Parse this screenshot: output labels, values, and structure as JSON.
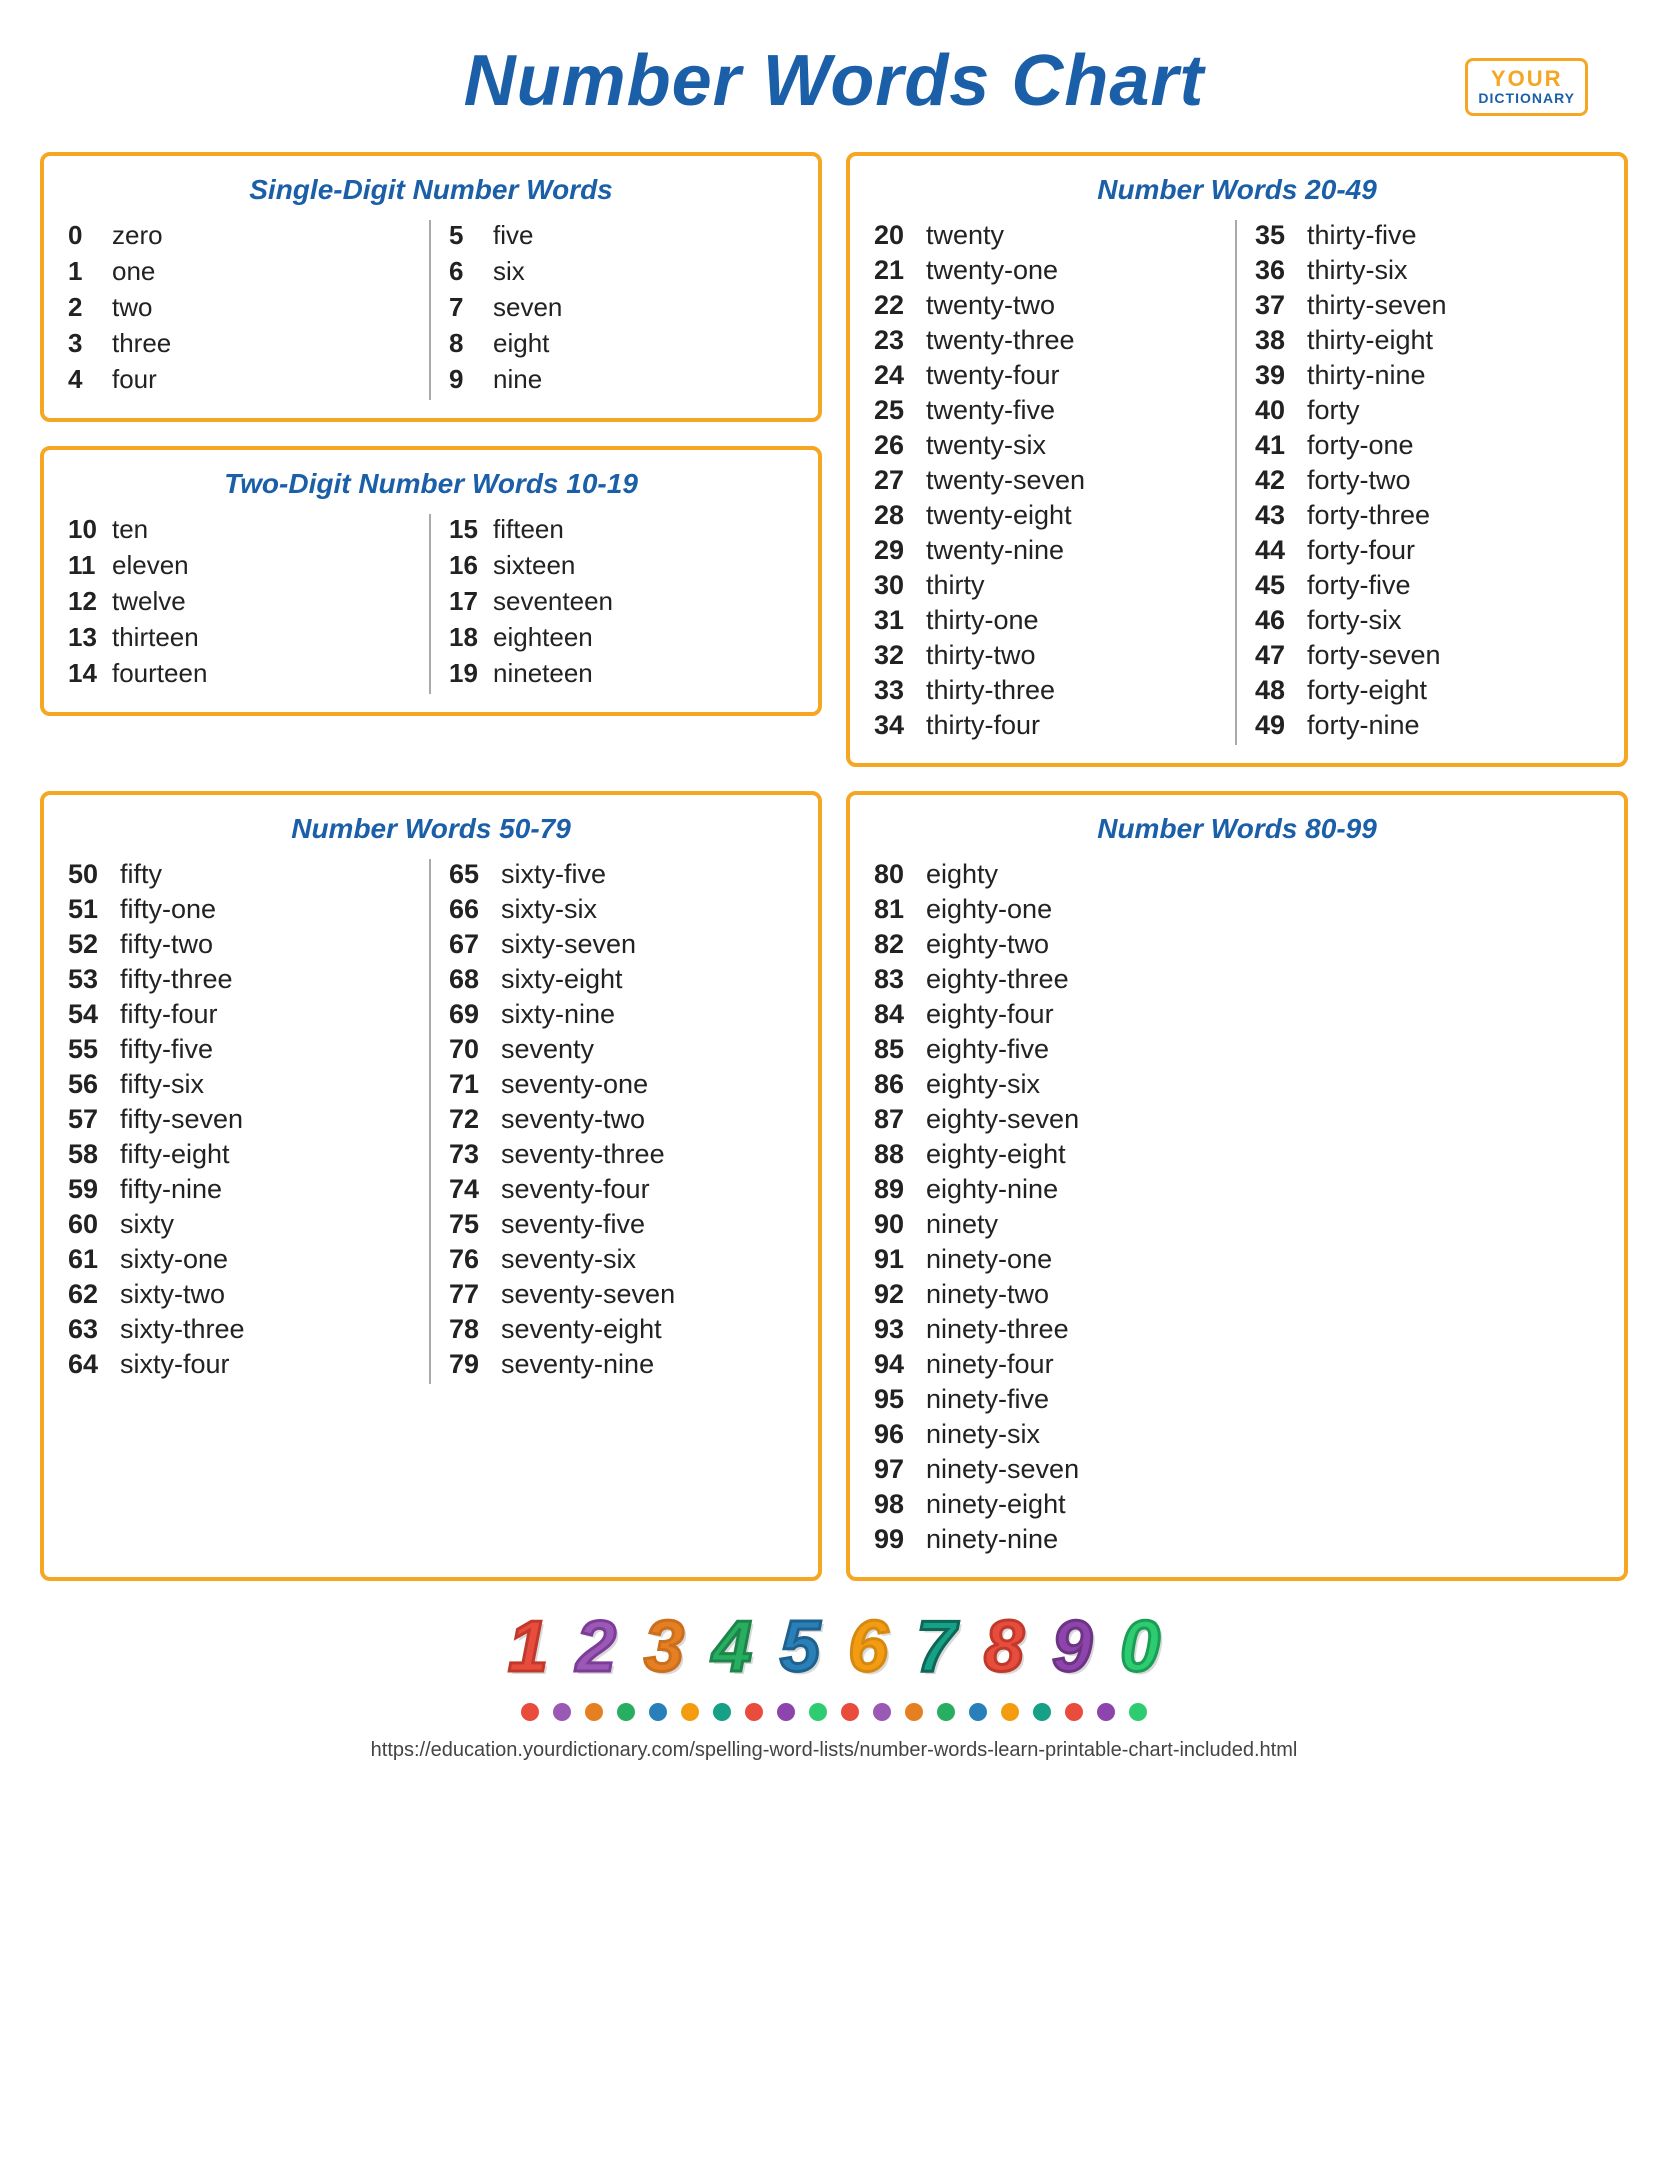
{
  "logo": {
    "your": "YOUR",
    "dictionary": "DICTIONARY"
  },
  "title": "Number Words Chart",
  "boxes": {
    "single_digit": {
      "title": "Single-Digit Number Words",
      "col1": [
        {
          "num": "0",
          "word": "zero"
        },
        {
          "num": "1",
          "word": "one"
        },
        {
          "num": "2",
          "word": "two"
        },
        {
          "num": "3",
          "word": "three"
        },
        {
          "num": "4",
          "word": "four"
        }
      ],
      "col2": [
        {
          "num": "5",
          "word": "five"
        },
        {
          "num": "6",
          "word": "six"
        },
        {
          "num": "7",
          "word": "seven"
        },
        {
          "num": "8",
          "word": "eight"
        },
        {
          "num": "9",
          "word": "nine"
        }
      ]
    },
    "two_digit": {
      "title": "Two-Digit Number Words 10-19",
      "col1": [
        {
          "num": "10",
          "word": "ten"
        },
        {
          "num": "11",
          "word": "eleven"
        },
        {
          "num": "12",
          "word": "twelve"
        },
        {
          "num": "13",
          "word": "thirteen"
        },
        {
          "num": "14",
          "word": "fourteen"
        }
      ],
      "col2": [
        {
          "num": "15",
          "word": "fifteen"
        },
        {
          "num": "16",
          "word": "sixteen"
        },
        {
          "num": "17",
          "word": "seventeen"
        },
        {
          "num": "18",
          "word": "eighteen"
        },
        {
          "num": "19",
          "word": "nineteen"
        }
      ]
    },
    "twenties": {
      "title": "Number Words 20-49",
      "col1": [
        {
          "num": "20",
          "word": "twenty"
        },
        {
          "num": "21",
          "word": "twenty-one"
        },
        {
          "num": "22",
          "word": "twenty-two"
        },
        {
          "num": "23",
          "word": "twenty-three"
        },
        {
          "num": "24",
          "word": "twenty-four"
        },
        {
          "num": "25",
          "word": "twenty-five"
        },
        {
          "num": "26",
          "word": "twenty-six"
        },
        {
          "num": "27",
          "word": "twenty-seven"
        },
        {
          "num": "28",
          "word": "twenty-eight"
        },
        {
          "num": "29",
          "word": "twenty-nine"
        },
        {
          "num": "30",
          "word": "thirty"
        },
        {
          "num": "31",
          "word": "thirty-one"
        },
        {
          "num": "32",
          "word": "thirty-two"
        },
        {
          "num": "33",
          "word": "thirty-three"
        },
        {
          "num": "34",
          "word": "thirty-four"
        }
      ],
      "col2": [
        {
          "num": "35",
          "word": "thirty-five"
        },
        {
          "num": "36",
          "word": "thirty-six"
        },
        {
          "num": "37",
          "word": "thirty-seven"
        },
        {
          "num": "38",
          "word": "thirty-eight"
        },
        {
          "num": "39",
          "word": "thirty-nine"
        },
        {
          "num": "40",
          "word": "forty"
        },
        {
          "num": "41",
          "word": "forty-one"
        },
        {
          "num": "42",
          "word": "forty-two"
        },
        {
          "num": "43",
          "word": "forty-three"
        },
        {
          "num": "44",
          "word": "forty-four"
        },
        {
          "num": "45",
          "word": "forty-five"
        },
        {
          "num": "46",
          "word": "forty-six"
        },
        {
          "num": "47",
          "word": "forty-seven"
        },
        {
          "num": "48",
          "word": "forty-eight"
        },
        {
          "num": "49",
          "word": "forty-nine"
        }
      ]
    },
    "fifties": {
      "title": "Number Words 50-79",
      "col1": [
        {
          "num": "50",
          "word": "fifty"
        },
        {
          "num": "51",
          "word": "fifty-one"
        },
        {
          "num": "52",
          "word": "fifty-two"
        },
        {
          "num": "53",
          "word": "fifty-three"
        },
        {
          "num": "54",
          "word": "fifty-four"
        },
        {
          "num": "55",
          "word": "fifty-five"
        },
        {
          "num": "56",
          "word": "fifty-six"
        },
        {
          "num": "57",
          "word": "fifty-seven"
        },
        {
          "num": "58",
          "word": "fifty-eight"
        },
        {
          "num": "59",
          "word": "fifty-nine"
        },
        {
          "num": "60",
          "word": "sixty"
        },
        {
          "num": "61",
          "word": "sixty-one"
        },
        {
          "num": "62",
          "word": "sixty-two"
        },
        {
          "num": "63",
          "word": "sixty-three"
        },
        {
          "num": "64",
          "word": "sixty-four"
        }
      ],
      "col2": [
        {
          "num": "65",
          "word": "sixty-five"
        },
        {
          "num": "66",
          "word": "sixty-six"
        },
        {
          "num": "67",
          "word": "sixty-seven"
        },
        {
          "num": "68",
          "word": "sixty-eight"
        },
        {
          "num": "69",
          "word": "sixty-nine"
        },
        {
          "num": "70",
          "word": "seventy"
        },
        {
          "num": "71",
          "word": "seventy-one"
        },
        {
          "num": "72",
          "word": "seventy-two"
        },
        {
          "num": "73",
          "word": "seventy-three"
        },
        {
          "num": "74",
          "word": "seventy-four"
        },
        {
          "num": "75",
          "word": "seventy-five"
        },
        {
          "num": "76",
          "word": "seventy-six"
        },
        {
          "num": "77",
          "word": "seventy-seven"
        },
        {
          "num": "78",
          "word": "seventy-eight"
        },
        {
          "num": "79",
          "word": "seventy-nine"
        }
      ]
    },
    "eighties": {
      "title": "Number Words 80-99",
      "col1": [
        {
          "num": "80",
          "word": "eighty"
        },
        {
          "num": "81",
          "word": "eighty-one"
        },
        {
          "num": "82",
          "word": "eighty-two"
        },
        {
          "num": "83",
          "word": "eighty-three"
        },
        {
          "num": "84",
          "word": "eighty-four"
        },
        {
          "num": "85",
          "word": "eighty-five"
        },
        {
          "num": "86",
          "word": "eighty-six"
        },
        {
          "num": "87",
          "word": "eighty-seven"
        },
        {
          "num": "88",
          "word": "eighty-eight"
        },
        {
          "num": "89",
          "word": "eighty-nine"
        },
        {
          "num": "90",
          "word": "ninety"
        },
        {
          "num": "91",
          "word": "ninety-one"
        },
        {
          "num": "92",
          "word": "ninety-two"
        },
        {
          "num": "93",
          "word": "ninety-three"
        },
        {
          "num": "94",
          "word": "ninety-four"
        },
        {
          "num": "95",
          "word": "ninety-five"
        },
        {
          "num": "96",
          "word": "ninety-six"
        },
        {
          "num": "97",
          "word": "ninety-seven"
        },
        {
          "num": "98",
          "word": "ninety-eight"
        },
        {
          "num": "99",
          "word": "ninety-nine"
        }
      ]
    }
  },
  "deco_numbers": [
    "1",
    "2",
    "3",
    "4",
    "5",
    "6",
    "7",
    "8",
    "9",
    "0"
  ],
  "dot_colors": [
    "#e74c3c",
    "#9b59b6",
    "#e67e22",
    "#27ae60",
    "#2980b9",
    "#f39c12",
    "#16a085",
    "#e74c3c",
    "#8e44ad",
    "#2ecc71",
    "#e74c3c",
    "#9b59b6",
    "#e67e22",
    "#27ae60",
    "#2980b9",
    "#f39c12",
    "#16a085",
    "#e74c3c",
    "#8e44ad",
    "#2ecc71"
  ],
  "footer_url": "https://education.yourdictionary.com/spelling-word-lists/number-words-learn-printable-chart-included.html"
}
